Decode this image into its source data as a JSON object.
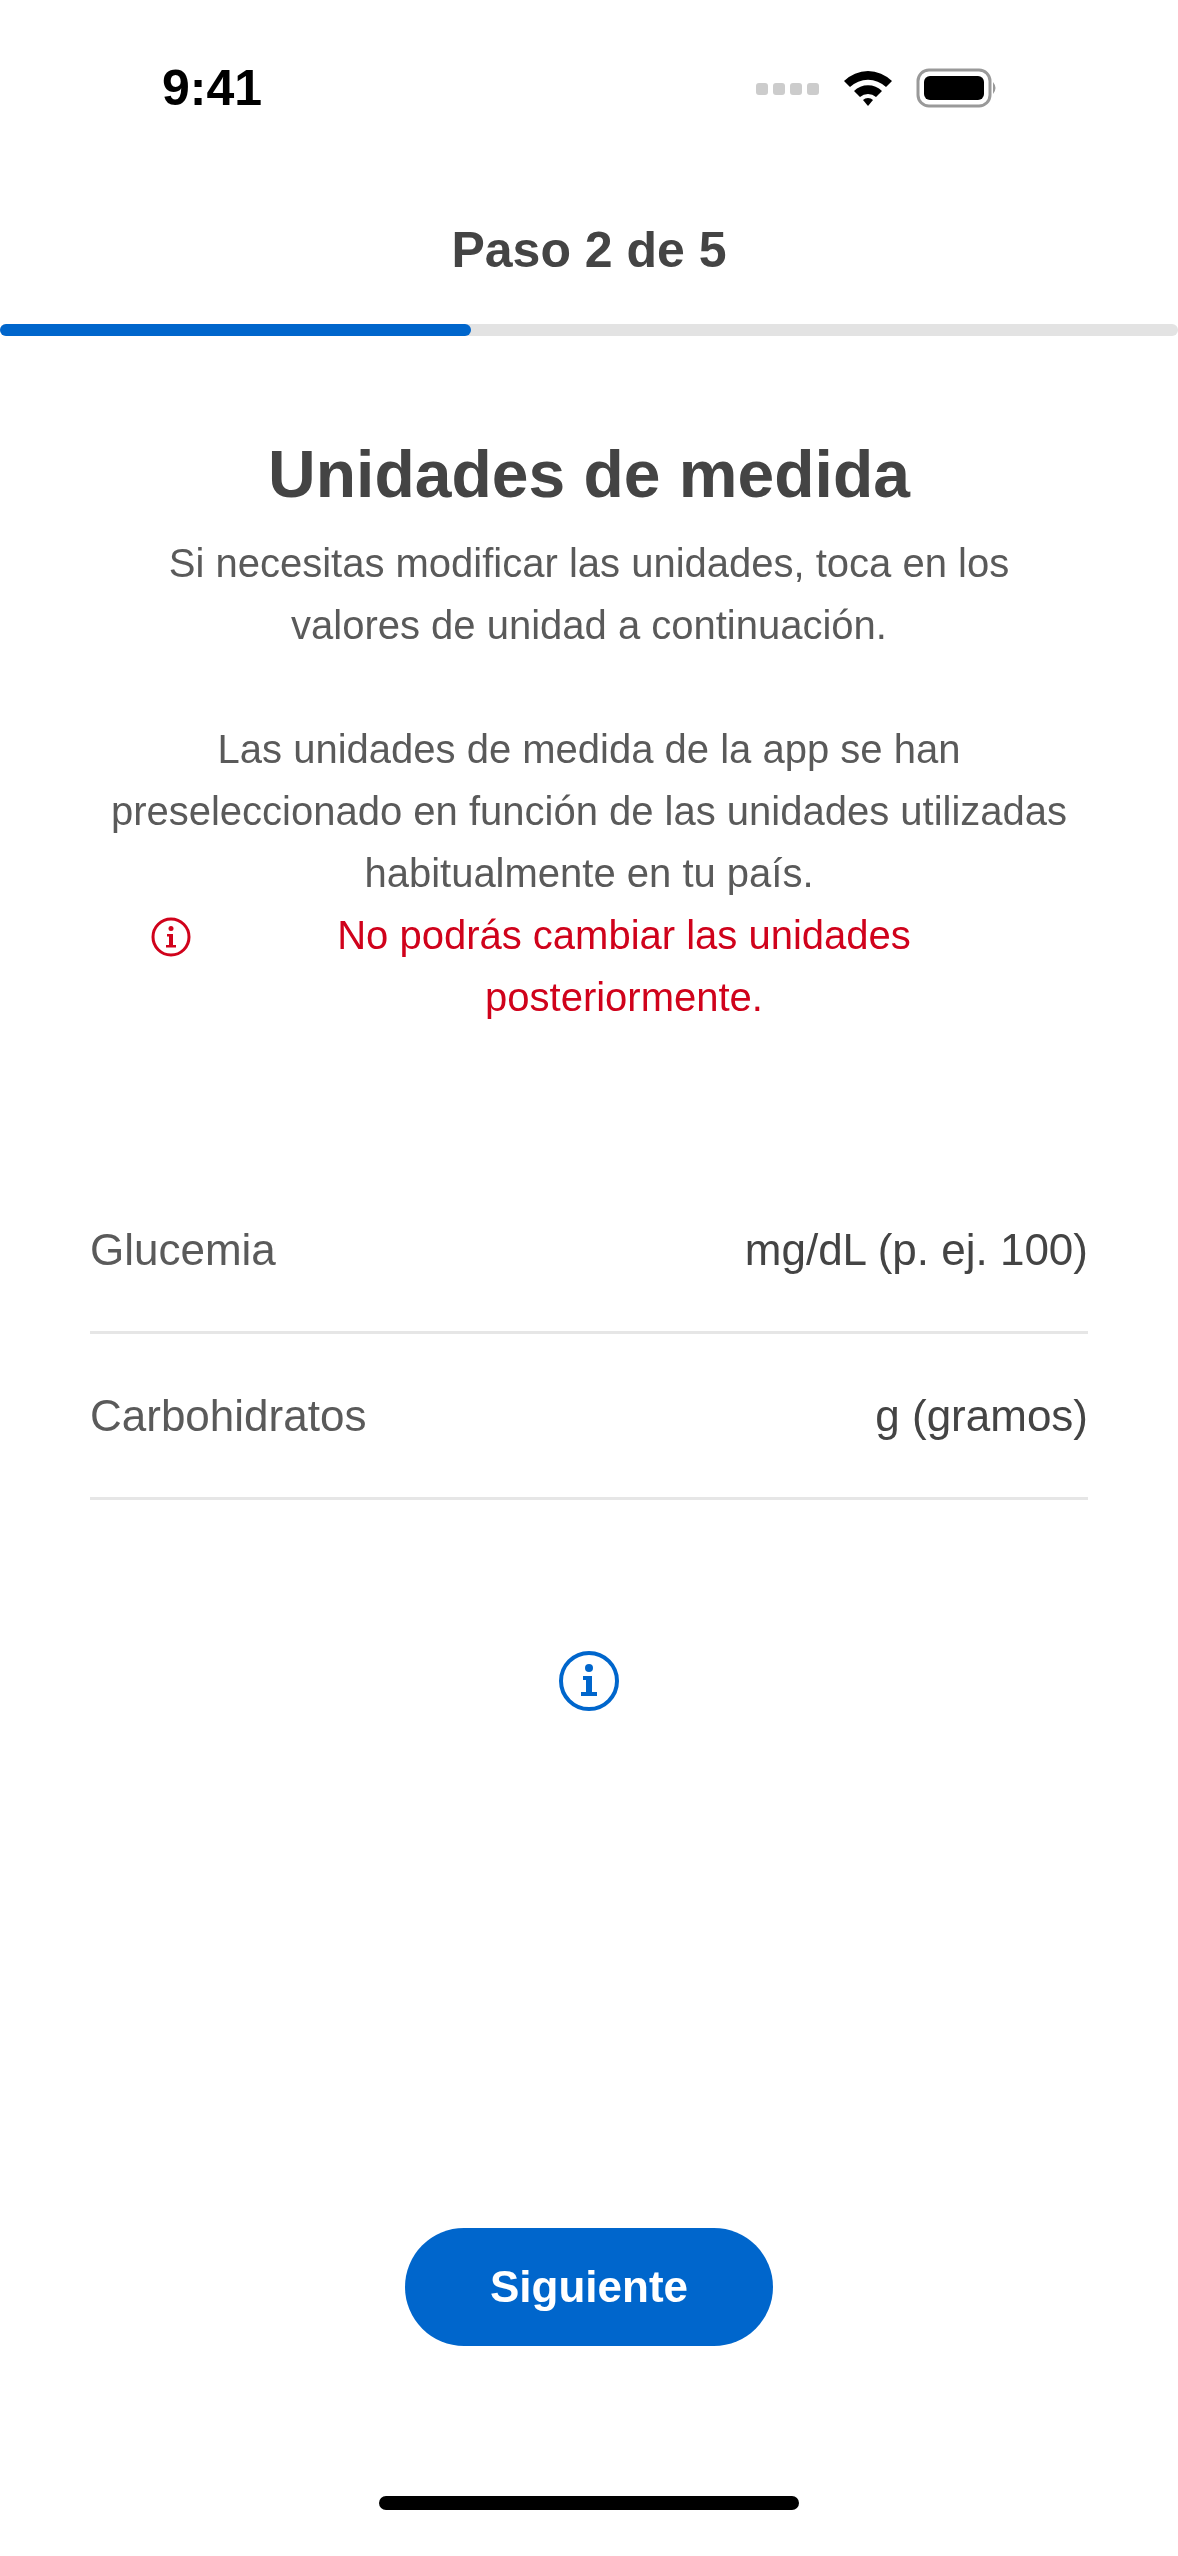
{
  "status_bar": {
    "time": "9:41"
  },
  "header": {
    "title": "Paso 2 de 5",
    "progress": {
      "level": 0.4
    }
  },
  "heading": "Unidades de medida",
  "paragraphs": [
    "Si necesitas modificar las unidades, toca en los valores de unidad a continuación.",
    "Las unidades de medida de la app se han preseleccionado en función de las unidades utilizadas habitualmente en tu país."
  ],
  "warning": "No podrás cambiar las unidades posteriormente.",
  "units": [
    {
      "label": "Glucemia",
      "value": "mg/dL (p. ej. 100)"
    },
    {
      "label": "Carbohidratos",
      "value": "g (gramos)"
    }
  ],
  "next_button": "Siguiente"
}
